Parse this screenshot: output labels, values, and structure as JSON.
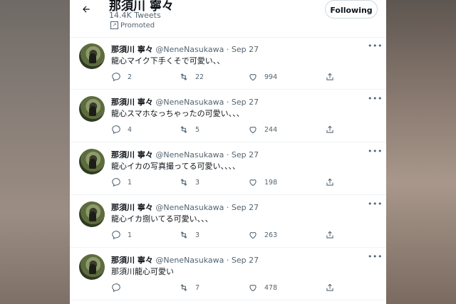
{
  "header": {
    "name": "那須川 寧々",
    "tweet_count": "14.4K Tweets",
    "promoted": "Promoted",
    "follow_label": "Following"
  },
  "tweets": [
    {
      "name": "那須川 寧々",
      "handle": "@NeneNasukawa",
      "date": "Sep 27",
      "text": "龍心マイク下手くそで可愛い、、",
      "replies": "2",
      "retweets": "22",
      "likes": "994"
    },
    {
      "name": "那須川 寧々",
      "handle": "@NeneNasukawa",
      "date": "Sep 27",
      "text": "龍心スマホなっちゃったの可愛い、、、",
      "replies": "4",
      "retweets": "5",
      "likes": "244"
    },
    {
      "name": "那須川 寧々",
      "handle": "@NeneNasukawa",
      "date": "Sep 27",
      "text": "龍心イカの写真撮ってる可愛い、、、、",
      "replies": "1",
      "retweets": "3",
      "likes": "198"
    },
    {
      "name": "那須川 寧々",
      "handle": "@NeneNasukawa",
      "date": "Sep 27",
      "text": "龍心イカ捌いてる可愛い、、、",
      "replies": "1",
      "retweets": "3",
      "likes": "263"
    },
    {
      "name": "那須川 寧々",
      "handle": "@NeneNasukawa",
      "date": "Sep 27",
      "text": "那須川龍心可愛い",
      "replies": "",
      "retweets": "7",
      "likes": "478"
    }
  ],
  "icons": [
    "back-arrow-icon",
    "promoted-icon",
    "more-icon",
    "reply-icon",
    "retweet-icon",
    "like-icon",
    "share-icon",
    "avatar"
  ],
  "colors": {
    "text": "#0f1419",
    "secondary": "#536471",
    "divider": "#eff3f4",
    "background": "#ffffff"
  }
}
